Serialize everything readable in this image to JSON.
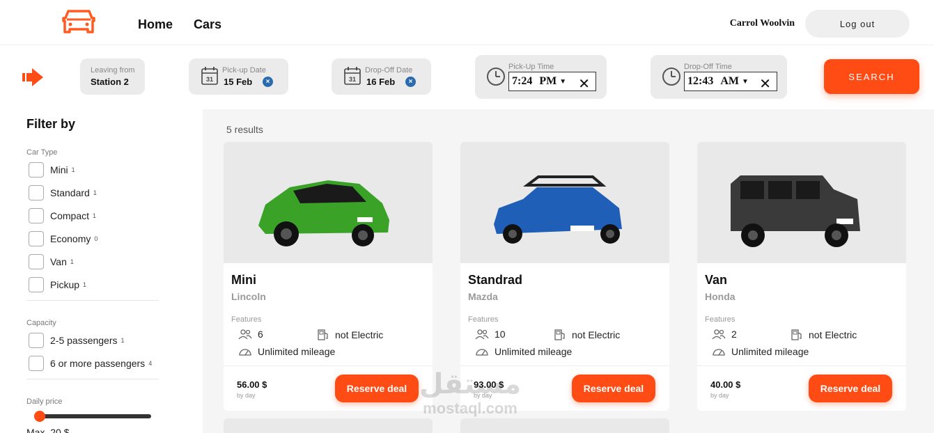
{
  "nav": {
    "home": "Home",
    "cars": "Cars",
    "user_name": "Carrol Woolvin",
    "logout": "Log out"
  },
  "search": {
    "leaving_label": "Leaving from",
    "leaving_value": "Station 2",
    "pickup_date_label": "Pick-up Date",
    "pickup_date_value": "15 Feb",
    "dropoff_date_label": "Drop-Off Date",
    "dropoff_date_value": "16 Feb",
    "calendar_day": "31",
    "pickup_time_label": "Pick-Up Time",
    "pickup_time_value": "7:24",
    "pickup_time_ampm": "PM",
    "dropoff_time_label": "Drop-Off Time",
    "dropoff_time_value": "12:43",
    "dropoff_time_ampm": "AM",
    "button": "SEARCH"
  },
  "sidebar": {
    "title": "Filter by",
    "car_type_title": "Car Type",
    "car_types": [
      {
        "label": "Mini",
        "count": "1"
      },
      {
        "label": "Standard",
        "count": "1"
      },
      {
        "label": "Compact",
        "count": "1"
      },
      {
        "label": "Economy",
        "count": "0"
      },
      {
        "label": "Van",
        "count": "1"
      },
      {
        "label": "Pickup",
        "count": "1"
      }
    ],
    "capacity_title": "Capacity",
    "capacities": [
      {
        "label": "2-5 passengers",
        "count": "1"
      },
      {
        "label": "6 or more passengers",
        "count": "4"
      }
    ],
    "price_title": "Daily price",
    "price_text": "Max. 20 $"
  },
  "results": {
    "count_text": "5 results",
    "features_label": "Features",
    "by_day": "by day",
    "reserve_label": "Reserve deal",
    "cars": [
      {
        "name": "Mini",
        "brand": "Lincoln",
        "passengers": "6",
        "electric": "not Electric",
        "mileage": "Unlimited mileage",
        "price": "56.00 $",
        "color": "#3aa227"
      },
      {
        "name": "Standrad",
        "brand": "Mazda",
        "passengers": "10",
        "electric": "not Electric",
        "mileage": "Unlimited mileage",
        "price": "93.00 $",
        "color": "#1f5fb8"
      },
      {
        "name": "Van",
        "brand": "Honda",
        "passengers": "2",
        "electric": "not Electric",
        "mileage": "Unlimited mileage",
        "price": "40.00 $",
        "color": "#3a3a3a"
      }
    ]
  },
  "watermark": {
    "arabic": "مستقل",
    "latin": "mostaql.com"
  },
  "colors": {
    "accent": "#ff4b14",
    "clear_badge": "#2a6bb0"
  }
}
